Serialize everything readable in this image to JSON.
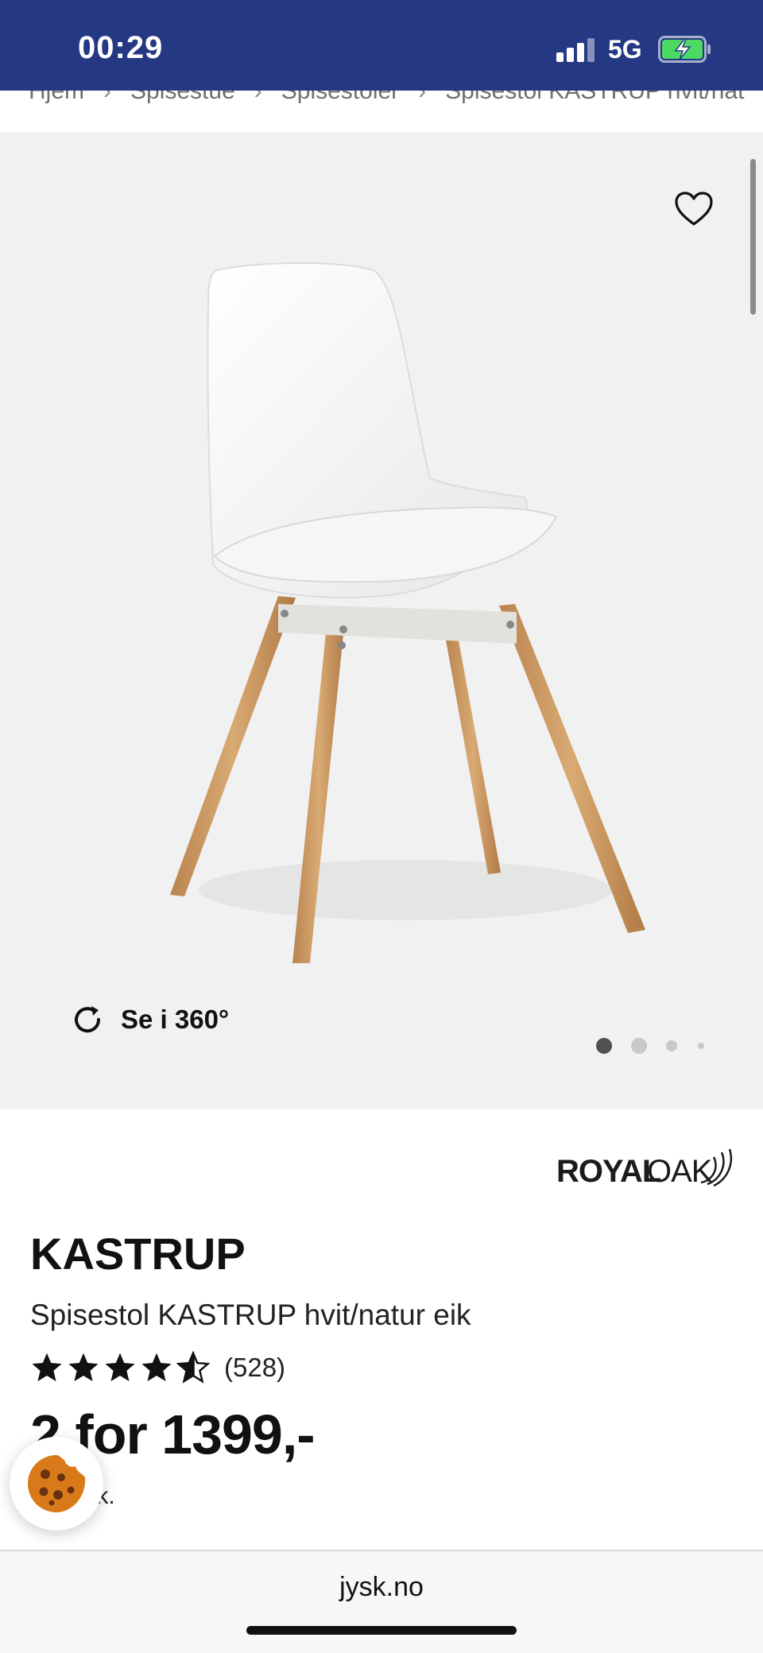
{
  "status_bar": {
    "time": "00:29",
    "network": "5G",
    "bg_color": "#253883",
    "signal_icon": "signal-icon",
    "battery_icon": "battery-charging-icon"
  },
  "breadcrumb": {
    "items": [
      "Hjem",
      "Spisestue",
      "Spisestoler",
      "Spisestol KASTRUP hvit/nat"
    ]
  },
  "gallery": {
    "view_360_label": "Se i 360°",
    "favorite_icon": "heart-icon",
    "rotate_icon": "rotate-icon",
    "image_count": 4,
    "active_index": 0
  },
  "product": {
    "brand": {
      "part1": "ROYAL",
      "part2": "OAK"
    },
    "name": "KASTRUP",
    "subtitle": "Spisestol KASTRUP hvit/natur eik",
    "rating": {
      "stars": 4.5,
      "max": 5,
      "count": "(528)"
    },
    "price": "2 for 1399,-",
    "unit": "stk."
  },
  "cookie_button": {
    "icon": "cookie-icon"
  },
  "browser": {
    "url": "jysk.no"
  }
}
